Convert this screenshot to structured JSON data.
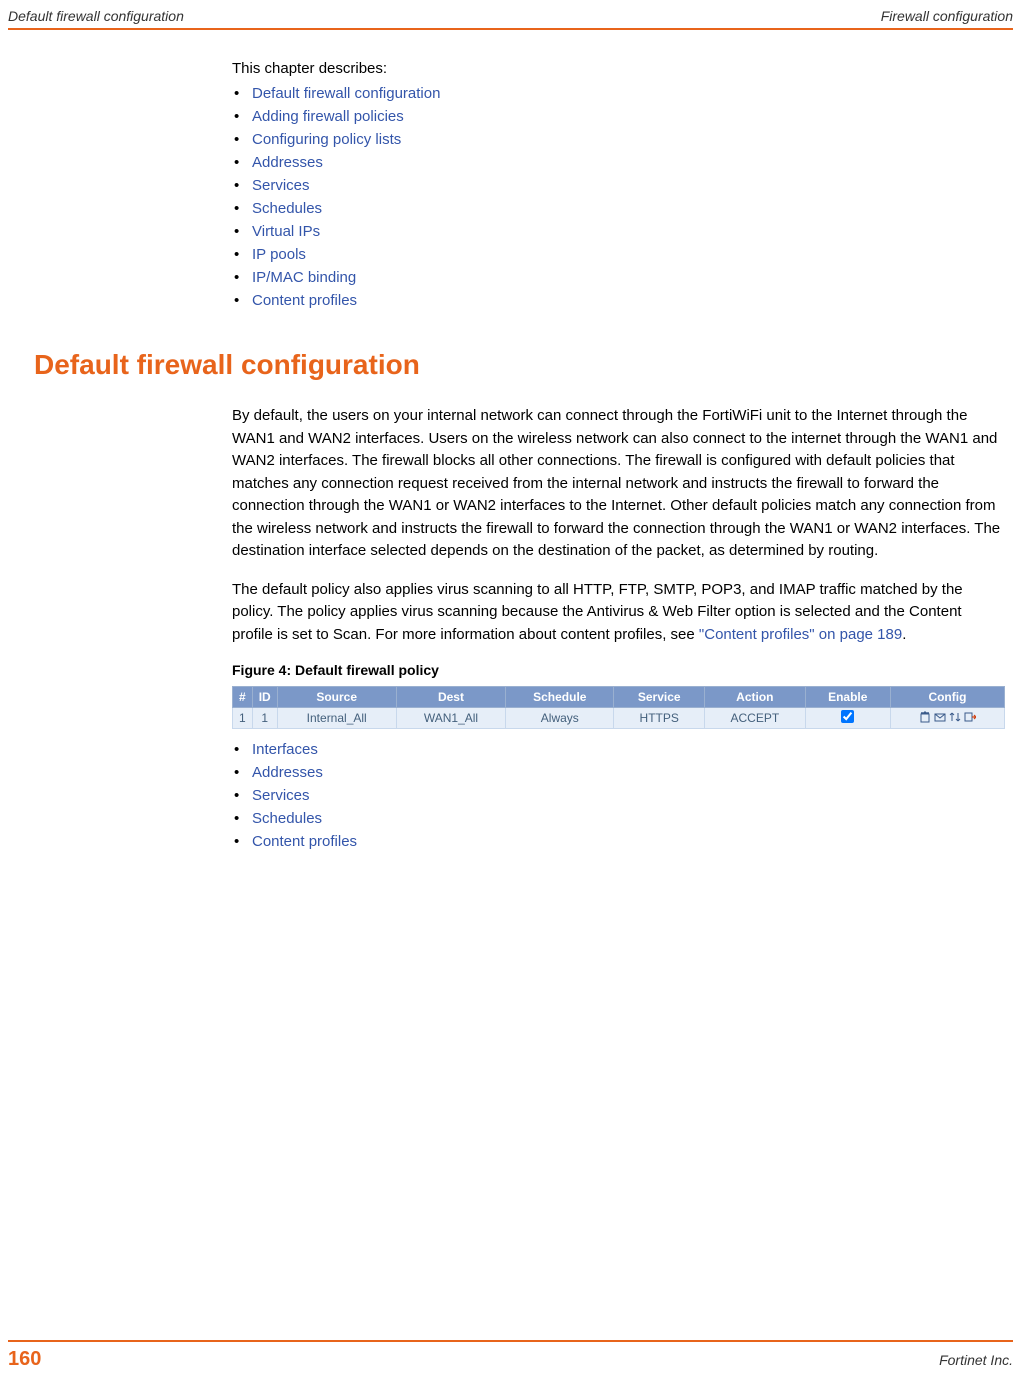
{
  "header": {
    "left": "Default firewall configuration",
    "right": "Firewall configuration"
  },
  "intro": "This chapter describes:",
  "chapter_links": [
    "Default firewall configuration",
    "Adding firewall policies",
    "Configuring policy lists",
    "Addresses",
    "Services",
    "Schedules",
    "Virtual IPs",
    "IP pools",
    "IP/MAC binding",
    "Content profiles"
  ],
  "section_heading": "Default firewall configuration",
  "para1": "By default, the users on your internal network can connect through the FortiWiFi unit to the Internet through the WAN1 and WAN2 interfaces. Users on the wireless network can also connect to the internet through the WAN1 and WAN2 interfaces. The firewall blocks all other connections. The firewall is configured with default policies that matches any connection request received from the internal network and instructs the firewall to forward the connection through the WAN1 or WAN2 interfaces to the Internet. Other default policies match any connection from the wireless network and instructs the firewall to forward the connection through the WAN1 or WAN2 interfaces. The destination interface selected depends on the destination of the packet, as determined by routing.",
  "para2_a": "The default policy also applies virus scanning to all HTTP, FTP, SMTP, POP3, and IMAP traffic matched by the policy. The policy applies virus scanning because the Antivirus & Web Filter option is selected and the Content profile is set to Scan. For more information about content profiles, see ",
  "para2_link": "\"Content profiles\" on page 189",
  "para2_b": ".",
  "figure_caption": "Figure 4:   Default firewall policy",
  "table": {
    "headers": [
      "#",
      "ID",
      "Source",
      "Dest",
      "Schedule",
      "Service",
      "Action",
      "Enable",
      "Config"
    ],
    "row": {
      "num": "1",
      "id": "1",
      "source": "Internal_All",
      "dest": "WAN1_All",
      "schedule": "Always",
      "service": "HTTPS",
      "action": "ACCEPT",
      "enable_checked": true
    }
  },
  "sub_links": [
    "Interfaces",
    "Addresses",
    "Services",
    "Schedules",
    "Content profiles"
  ],
  "footer": {
    "page": "160",
    "company": "Fortinet Inc."
  }
}
